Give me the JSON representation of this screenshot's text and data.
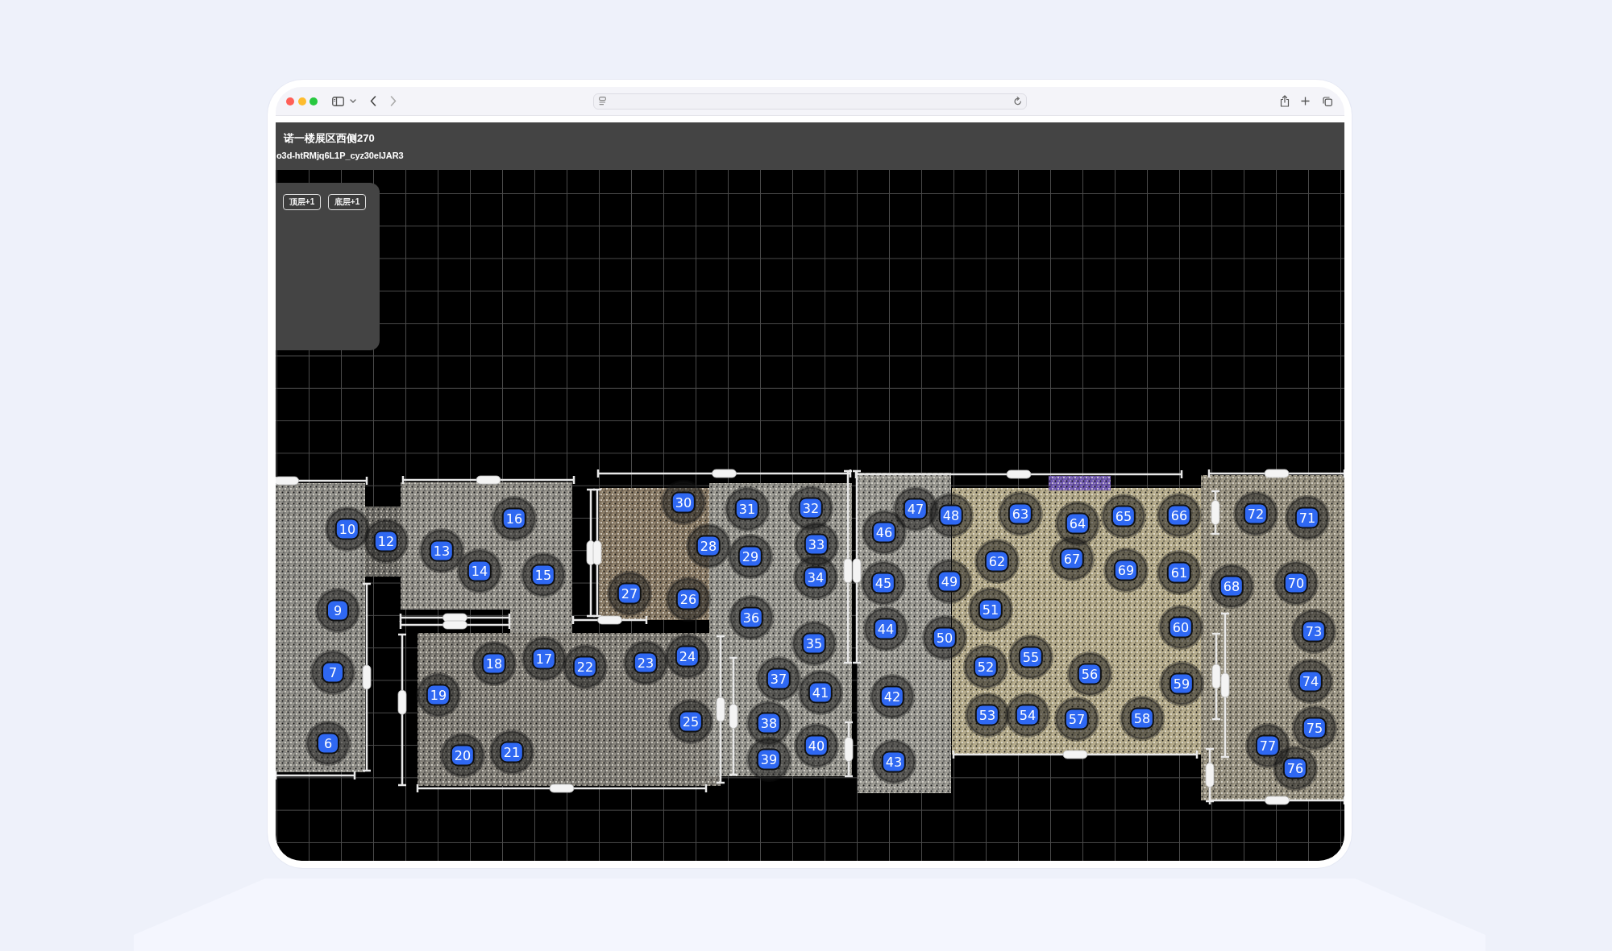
{
  "header": {
    "title": "诺一楼展区西侧270",
    "model_id": "o3d-htRMjq6L1P_cyz30eIJAR3"
  },
  "panel": {
    "buttons": [
      {
        "label": "顶层+1"
      },
      {
        "label": "底层+1"
      }
    ]
  },
  "floor_plan": {
    "markers": [
      "10",
      "16",
      "30",
      "31",
      "32",
      "47",
      "12",
      "13",
      "28",
      "14",
      "15",
      "29",
      "33",
      "46",
      "48",
      "63",
      "64",
      "65",
      "66",
      "72",
      "71",
      "9",
      "27",
      "26",
      "34",
      "45",
      "49",
      "62",
      "67",
      "69",
      "61",
      "68",
      "70",
      "36",
      "7",
      "18",
      "17",
      "22",
      "23",
      "24",
      "35",
      "44",
      "51",
      "50",
      "60",
      "73",
      "19",
      "37",
      "52",
      "55",
      "41",
      "42",
      "56",
      "59",
      "74",
      "25",
      "38",
      "53",
      "54",
      "57",
      "58",
      "6",
      "20",
      "21",
      "39",
      "40",
      "43",
      "77",
      "75",
      "76"
    ]
  }
}
